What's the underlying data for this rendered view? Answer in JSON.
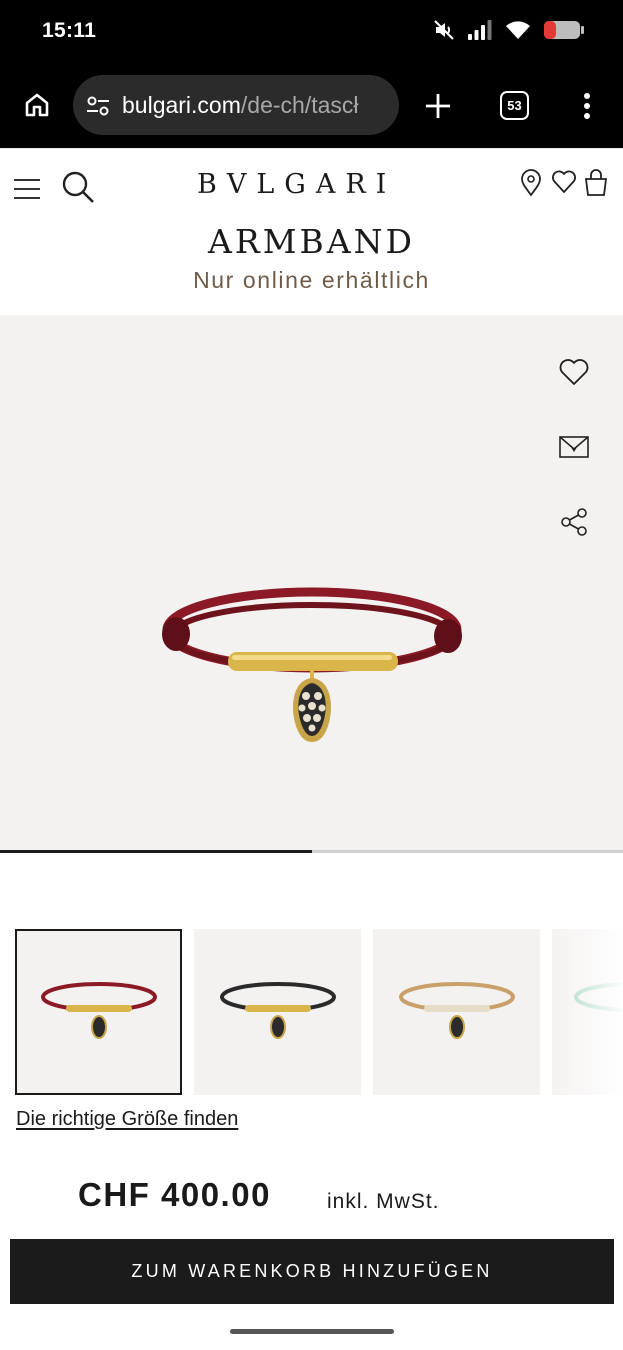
{
  "status_bar": {
    "time": "15:11",
    "icons": [
      "mute-icon",
      "signal-icon",
      "wifi-icon",
      "battery-icon"
    ],
    "battery_color": "#e53935"
  },
  "browser": {
    "url_host": "bulgari.com",
    "url_path": "/de-ch/tascł",
    "tab_count": "53",
    "icons": [
      "home-icon",
      "site-settings-icon",
      "plus-icon",
      "tabs-icon",
      "kebab-menu-icon"
    ]
  },
  "header": {
    "brand": "BVLGARI",
    "icons": [
      "hamburger-icon",
      "search-icon",
      "location-pin-icon",
      "heart-icon",
      "shopping-bag-icon"
    ]
  },
  "product": {
    "title": "ARMBAND",
    "availability": "Nur online erhältlich",
    "image_progress": 0.5,
    "hero_actions": [
      "heart-icon",
      "envelope-icon",
      "share-icon"
    ],
    "thumbnails": [
      {
        "variant": "red-cord-bracelet",
        "cord_color": "#8b1a26",
        "selected": true
      },
      {
        "variant": "black-cord-bracelet",
        "cord_color": "#2a2a2a",
        "selected": false
      },
      {
        "variant": "beige-cord-bracelet",
        "cord_color": "#c9a06a",
        "selected": false
      },
      {
        "variant": "mint-cord-bracelet",
        "cord_color": "#a6d6c0",
        "selected": false
      }
    ],
    "size_link": "Die richtige Größe finden",
    "price": "CHF 400.00",
    "vat_note": "inkl. MwSt.",
    "cta": "ZUM WARENKORB HINZUFÜGEN"
  },
  "colors": {
    "accent_brown": "#6f5b49",
    "button_bg": "#1b1b1b",
    "hero_bg": "#f4f2f1",
    "gold": "#d9b54a"
  }
}
